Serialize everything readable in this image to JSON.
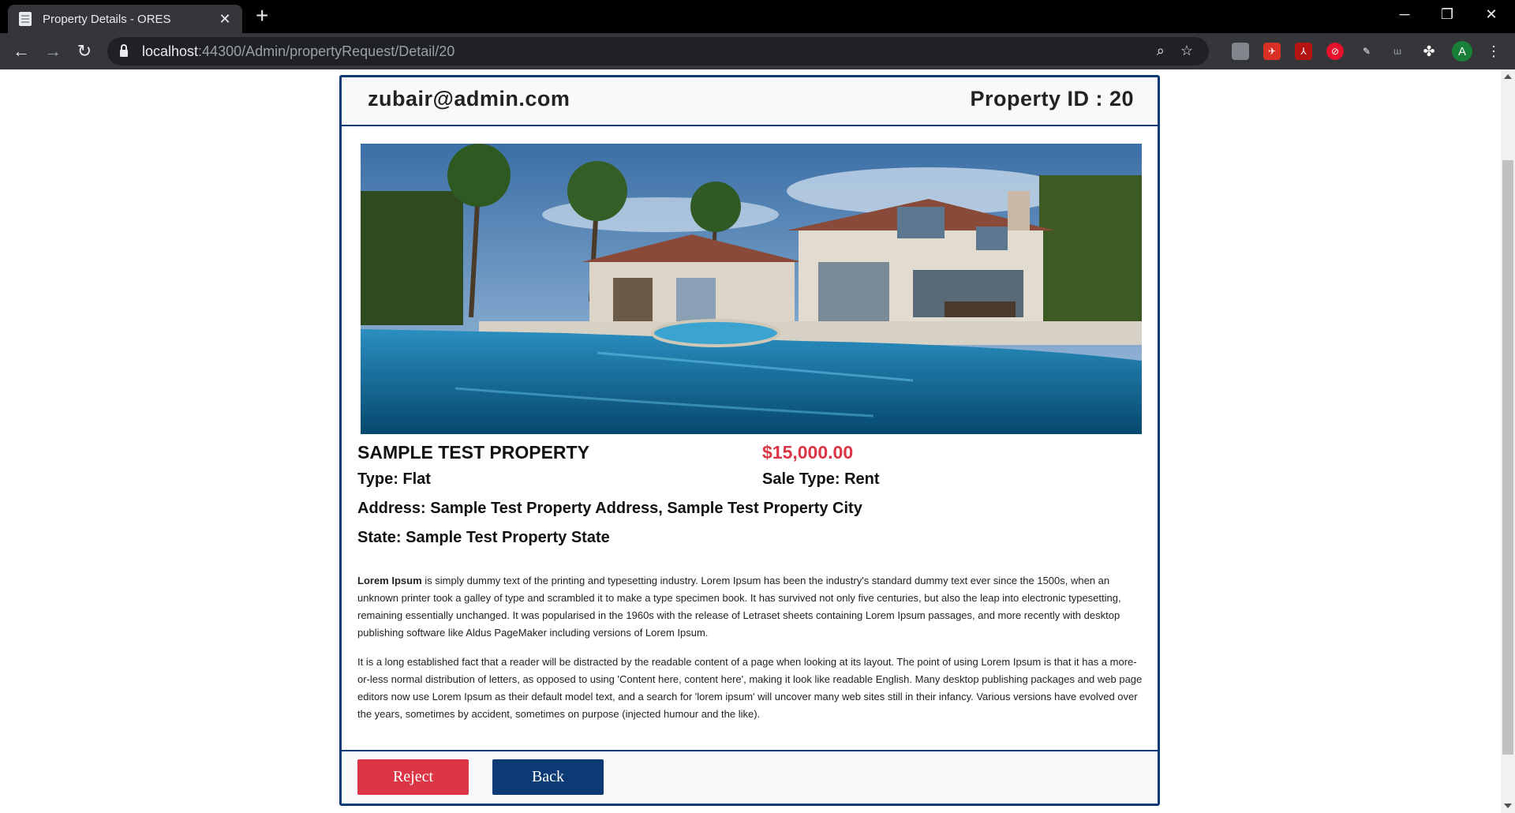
{
  "browser": {
    "tab_title": "Property Details - ORES",
    "tab_close": "✕",
    "new_tab": "+",
    "url_host": "localhost",
    "url_rest": ":44300/Admin/propertyRequest/Detail/20",
    "profile_initial": "A",
    "icons": [
      "back-arrow-icon",
      "forward-arrow-icon",
      "reload-icon",
      "lock-icon",
      "zoom-icon",
      "star-icon",
      "extensions-icon",
      "menu-icon"
    ]
  },
  "header": {
    "email": "zubair@admin.com",
    "property_id": "Property ID : 20"
  },
  "property": {
    "title": "SAMPLE TEST PROPERTY",
    "price": "$15,000.00",
    "type": "Type: Flat",
    "sale_type": "Sale Type: Rent",
    "address": "Address: Sample Test Property Address, Sample Test Property City",
    "state": "State: Sample Test Property State",
    "description_lead": "Lorem Ipsum",
    "description_1": " is simply dummy text of the printing and typesetting industry. Lorem Ipsum has been the industry's standard dummy text ever since the 1500s, when an unknown printer took a galley of type and scrambled it to make a type specimen book. It has survived not only five centuries, but also the leap into electronic typesetting, remaining essentially unchanged. It was popularised in the 1960s with the release of Letraset sheets containing Lorem Ipsum passages, and more recently with desktop publishing software like Aldus PageMaker including versions of Lorem Ipsum.",
    "description_2": "It is a long established fact that a reader will be distracted by the readable content of a page when looking at its layout. The point of using Lorem Ipsum is that it has a more-or-less normal distribution of letters, as opposed to using 'Content here, content here', making it look like readable English. Many desktop publishing packages and web page editors now use Lorem Ipsum as their default model text, and a search for 'lorem ipsum' will uncover many web sites still in their infancy. Various versions have evolved over the years, sometimes by accident, sometimes on purpose (injected humour and the like)."
  },
  "actions": {
    "reject": "Reject",
    "back": "Back"
  },
  "colors": {
    "accent_blue": "#0b3a75",
    "reject_red": "#dc3545",
    "price_red": "#dc3545"
  }
}
